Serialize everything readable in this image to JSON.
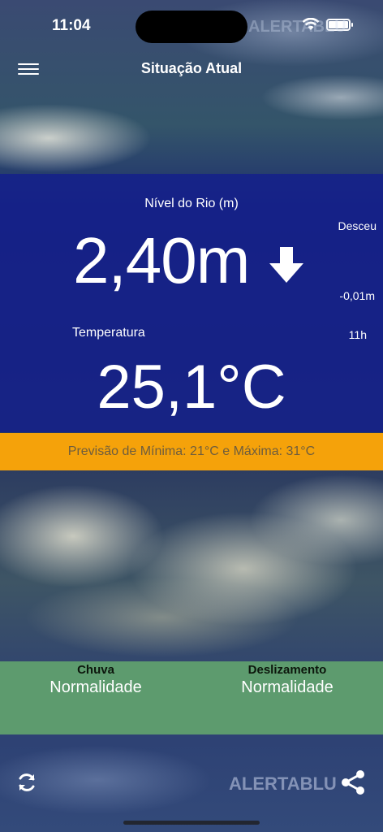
{
  "status_bar": {
    "time": "11:04"
  },
  "nav": {
    "title": "Situação Atual"
  },
  "brand": {
    "watermark": "ALERTABLU"
  },
  "river": {
    "label": "Nível do Rio (m)",
    "value": "2,40m",
    "trend": "Desceu",
    "delta": "-0,01m",
    "time": "11h"
  },
  "temperature": {
    "label": "Temperatura",
    "value": "25,1°C"
  },
  "forecast": {
    "text": "Previsão de Mínima: 21°C e Máxima: 31°C"
  },
  "alerts": [
    {
      "title": "Chuva",
      "status": "Normalidade"
    },
    {
      "title": "Deslizamento",
      "status": "Normalidade"
    }
  ],
  "colors": {
    "panel_blue": "#141e8c",
    "forecast_orange": "#f5a20a",
    "alert_green": "#60a06e"
  },
  "icons": {
    "menu": "menu-icon",
    "arrow": "down-arrow-icon",
    "refresh": "refresh-icon",
    "share": "share-icon"
  }
}
